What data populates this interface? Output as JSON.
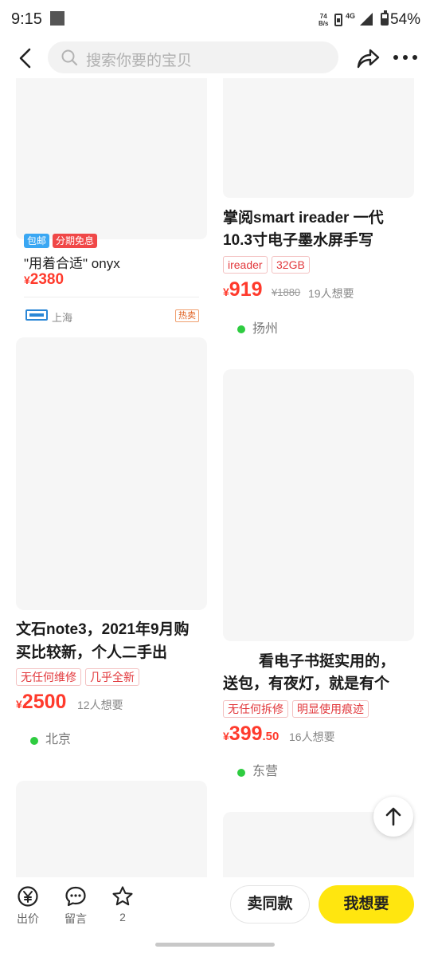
{
  "status_bar": {
    "time": "9:15",
    "speed_value": "74",
    "speed_unit": "B/s",
    "network": "4G",
    "battery": "54%"
  },
  "nav": {
    "search_placeholder": "搜索你要的宝贝",
    "icons": [
      "back-arrow-icon",
      "search-icon",
      "share-icon",
      "more-icon"
    ]
  },
  "feed": {
    "items": [
      {
        "tags": [
          "包邮",
          "分期免息"
        ],
        "title": "\"用着合适\" onyx",
        "currency": "¥",
        "price": "2380",
        "shop_location": "上海",
        "hot_badge": "热卖"
      },
      {
        "title_lines": [
          "掌阅smart ireader 一代",
          "10.3寸电子墨水屏手写"
        ],
        "tags": [
          "ireader",
          "32GB"
        ],
        "currency": "¥",
        "price": "919",
        "original_price": "¥1880",
        "want_count": "19人想要",
        "location": "扬州"
      },
      {
        "title_lines": [
          "文石note3，2021年9月购",
          "买比较新，个人二手出"
        ],
        "tags": [
          "无任何维修",
          "几乎全新"
        ],
        "currency": "¥",
        "price": "2500",
        "want_count": "12人想要",
        "location": "北京"
      },
      {
        "title_lines": [
          "看电子书挺实用的，",
          "送包，有夜灯，就是有个"
        ],
        "tags": [
          "无任何拆修",
          "明显使用痕迹"
        ],
        "currency": "¥",
        "price": "399",
        "price_decimal": ".50",
        "want_count": "16人想要",
        "location": "东营"
      }
    ]
  },
  "bottom_bar": {
    "offer_label": "出价",
    "comment_label": "留言",
    "favorite_count": "2",
    "sell_same_label": "卖同款",
    "want_label": "我想要"
  },
  "colors": {
    "price": "#ff3a2c",
    "accent_yellow": "#ffe60f",
    "tag_red": "#e2383c",
    "location_dot": "#2ecc40"
  }
}
